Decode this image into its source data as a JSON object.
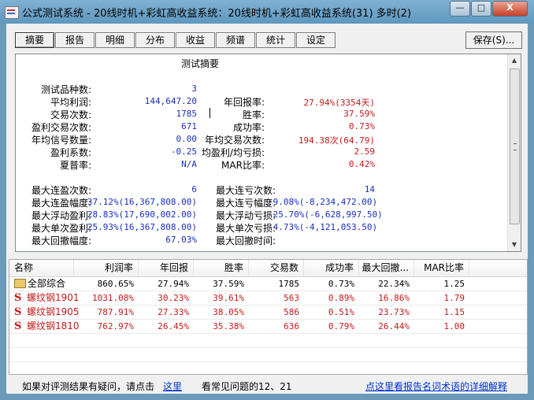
{
  "window": {
    "title": "公式测试系统 - 20线时机+彩虹高收益系统：20线时机+彩虹高收益系统(31) 多时(2)",
    "buttons": {
      "minimize": "—",
      "maximize": "□",
      "close": "X"
    }
  },
  "tabs": [
    {
      "label": "摘要",
      "active": true
    },
    {
      "label": "报告"
    },
    {
      "label": "明细"
    },
    {
      "label": "分布"
    },
    {
      "label": "收益"
    },
    {
      "label": "频谱"
    },
    {
      "label": "统计"
    },
    {
      "label": "设定"
    }
  ],
  "save_button": "保存(S)...",
  "summary": {
    "title": "测试摘要",
    "left": [
      {
        "label": "测试品种数:",
        "value": "3"
      },
      {
        "label": "平均利润:",
        "value": "144,647.20"
      },
      {
        "label": "交易次数:",
        "value": "1785"
      },
      {
        "label": "盈利交易次数:",
        "value": "671"
      },
      {
        "label": "年均信号数量:",
        "value": "0.00"
      },
      {
        "label": "盈利系数:",
        "value": "-0.25"
      },
      {
        "label": "夏普率:",
        "value": "N/A"
      }
    ],
    "right": [
      {
        "label": "年回报率:",
        "value": "27.94%(3354天)"
      },
      {
        "label": "胜率:",
        "value": "37.59%"
      },
      {
        "label": "成功率:",
        "value": "0.73%"
      },
      {
        "label": "年均交易次数:",
        "value": "194.38次(64.79)"
      },
      {
        "label": "均盈利/均亏损:",
        "value": "2.59"
      },
      {
        "label": "MAR比率:",
        "value": "0.42%"
      }
    ],
    "left2": [
      {
        "label": "最大连盈次数:",
        "value": "6"
      },
      {
        "label": "最大连盈幅度:",
        "value": "37.12%(16,367,808.00)"
      },
      {
        "label": "最大浮动盈利:",
        "value": "28.83%(17,690,002.00)"
      },
      {
        "label": "最大单次盈利:",
        "value": "25.93%(16,367,808.00)"
      },
      {
        "label": "最大回撤幅度:",
        "value": "67.03%"
      }
    ],
    "right2": [
      {
        "label": "最大连亏次数:",
        "value": "14"
      },
      {
        "label": "最大连亏幅度:",
        "value": "-9.08%(-8,234,472.00)"
      },
      {
        "label": "最大浮动亏损:",
        "value": "-25.70%(-6,628,997.50)"
      },
      {
        "label": "最大单次亏损:",
        "value": "-4.73%(-4,121,053.50)"
      },
      {
        "label": "最大回撤时间:",
        "value": ""
      }
    ]
  },
  "table": {
    "headers": [
      "名称",
      "利润率",
      "年回报",
      "胜率",
      "交易数",
      "成功率",
      "最大回撤...",
      "MAR比率"
    ],
    "rows": [
      {
        "name": "全部综合",
        "icon": "folder-icon",
        "cells": [
          "860.65%",
          "27.94%",
          "37.59%",
          "1785",
          "0.73%",
          "22.34%",
          "1.25"
        ]
      },
      {
        "name": "螺纹钢1901",
        "icon": "s-icon",
        "cells": [
          "1031.08%",
          "30.23%",
          "39.61%",
          "563",
          "0.89%",
          "16.86%",
          "1.79"
        ]
      },
      {
        "name": "螺纹钢1905",
        "icon": "s-icon",
        "cells": [
          "787.91%",
          "27.33%",
          "38.05%",
          "586",
          "0.51%",
          "23.73%",
          "1.15"
        ]
      },
      {
        "name": "螺纹钢1810",
        "icon": "s-icon",
        "cells": [
          "762.97%",
          "26.45%",
          "35.38%",
          "636",
          "0.79%",
          "26.44%",
          "1.00"
        ]
      }
    ],
    "icon_letter": "S"
  },
  "footer": {
    "text1": "如果对评测结果有疑问，请点击",
    "link1": "这里",
    "text2": "看常见问题的12、21",
    "link2": "点这里看报告名词术语的详细解释"
  },
  "colors": {
    "value_blue": "#1a2ebc",
    "value_red": "#c41a1a",
    "link": "#0033cc"
  }
}
